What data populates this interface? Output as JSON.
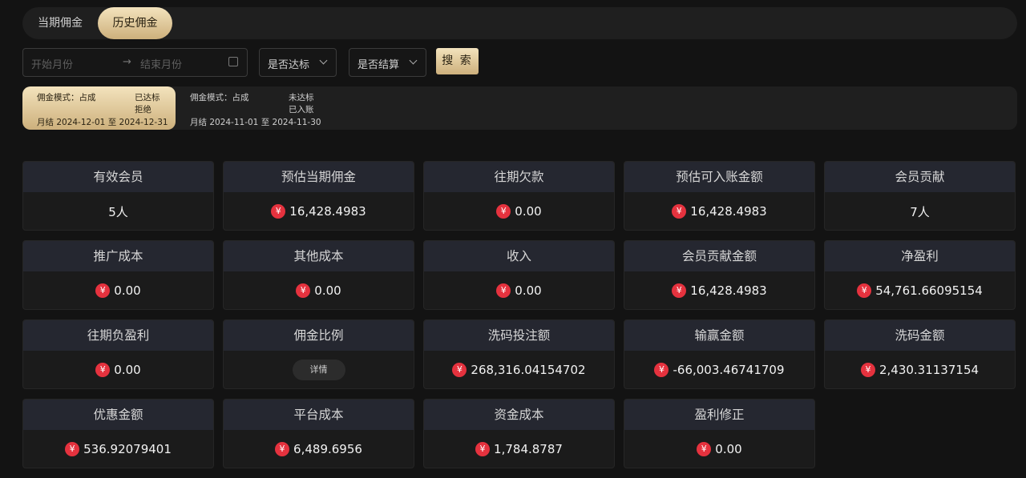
{
  "tabs": [
    "当期佣金",
    "历史佣金"
  ],
  "filters": {
    "start_placeholder": "开始月份",
    "arrow": "→",
    "end_placeholder": "结束月份",
    "select1": "是否达标",
    "select2": "是否结算",
    "search_label": "搜 索"
  },
  "periods": [
    {
      "mode": "佣金模式：占成",
      "status1": "已达标",
      "status2": "拒绝",
      "range": "月结 2024-12-01 至 2024-12-31"
    },
    {
      "mode": "佣金模式：占成",
      "status1": "未达标",
      "status2": "已入账",
      "range": "月结 2024-11-01 至 2024-11-30"
    }
  ],
  "currency_symbol": "¥",
  "cards": [
    {
      "label": "有效会员",
      "value": "5人"
    },
    {
      "label": "预估当期佣金",
      "value": "16,428.4983",
      "yen": true
    },
    {
      "label": "往期欠款",
      "value": "0.00",
      "yen": true
    },
    {
      "label": "预估可入账金额",
      "value": "16,428.4983",
      "yen": true
    },
    {
      "label": "会员贡献",
      "value": "7人"
    },
    {
      "label": "推广成本",
      "value": "0.00",
      "yen": true
    },
    {
      "label": "其他成本",
      "value": "0.00",
      "yen": true
    },
    {
      "label": "收入",
      "value": "0.00",
      "yen": true
    },
    {
      "label": "会员贡献金额",
      "value": "16,428.4983",
      "yen": true
    },
    {
      "label": "净盈利",
      "value": "54,761.66095154",
      "yen": true
    },
    {
      "label": "往期负盈利",
      "value": "0.00",
      "yen": true
    },
    {
      "label": "佣金比例",
      "button": "详情"
    },
    {
      "label": "洗码投注额",
      "value": "268,316.04154702",
      "yen": true
    },
    {
      "label": "输赢金额",
      "value": "-66,003.46741709",
      "yen": true
    },
    {
      "label": "洗码金额",
      "value": "2,430.31137154",
      "yen": true
    },
    {
      "label": "优惠金额",
      "value": "536.92079401",
      "yen": true
    },
    {
      "label": "平台成本",
      "value": "6,489.6956",
      "yen": true
    },
    {
      "label": "资金成本",
      "value": "1,784.8787",
      "yen": true
    },
    {
      "label": "盈利修正",
      "value": "0.00",
      "yen": true
    }
  ]
}
